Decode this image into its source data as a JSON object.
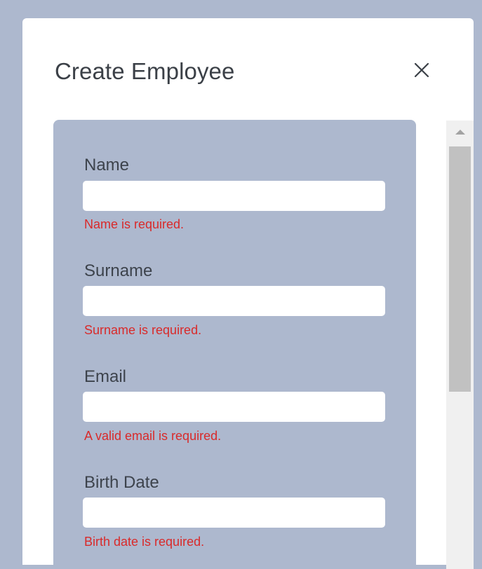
{
  "dialog": {
    "title": "Create Employee",
    "close_icon": "close-icon"
  },
  "form": {
    "fields": [
      {
        "label": "Name",
        "value": "",
        "placeholder": "",
        "error": "Name is required."
      },
      {
        "label": "Surname",
        "value": "",
        "placeholder": "",
        "error": "Surname is required."
      },
      {
        "label": "Email",
        "value": "",
        "placeholder": "",
        "error": "A valid email is required."
      },
      {
        "label": "Birth Date",
        "value": "",
        "placeholder": "",
        "error": "Birth date is required."
      }
    ]
  },
  "scrollbar": {
    "up_arrow_icon": "scroll-up-arrow-icon"
  },
  "colors": {
    "backdrop": "#adb8ce",
    "form_panel": "#adb8ce",
    "error_text": "#d92a2a",
    "label_text": "#3d434c",
    "title_text": "#3b4047"
  }
}
